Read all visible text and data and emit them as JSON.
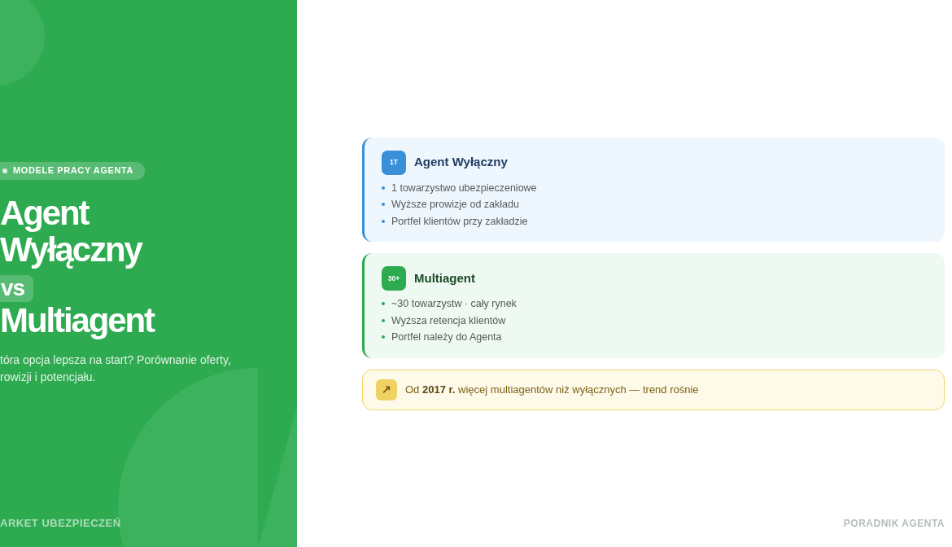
{
  "hero": {
    "tag": "MODELE PRACY AGENTA",
    "title_lines": [
      "Agent",
      "Wyłączny"
    ],
    "versus": "vs",
    "title_end": "Multiagent",
    "subtitle_lines": [
      "tóra opcja lepsza na start? Porównanie oferty,",
      "rowizji i potencjału."
    ],
    "footer": "ARKET UBEZPIECZEŃ"
  },
  "cards": [
    {
      "kind": "exclusive",
      "color": "#3a8fd9",
      "badge": "1T",
      "title": "Agent Wyłączny",
      "points": [
        "1 towarzystwo ubezpieczeniowe",
        "Wyższe prowizje od zakładu",
        "Portfel klientów przy zakładzie"
      ]
    },
    {
      "kind": "multi",
      "color": "#2eaa50",
      "badge": "30+",
      "title": "Multiagent",
      "points": [
        "~30 towarzystw · cały rynek",
        "Wyższa retencja klientów",
        "Portfel należy do Agenta"
      ]
    }
  ],
  "note": {
    "icon": "↗",
    "text": "Od **2017 r.** więcej multiagentów niż wyłącznych — trend rośnie"
  },
  "footer": "PORADNIK AGENTA"
}
